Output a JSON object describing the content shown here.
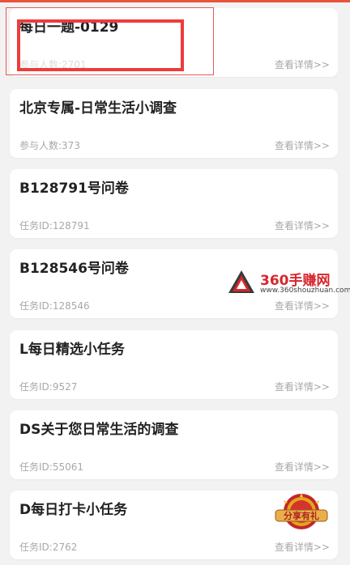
{
  "colors": {
    "accent": "#e8533a",
    "highlight": "#ef3b3b",
    "meta_text": "#a8a8a8"
  },
  "cards": [
    {
      "title": "每日一题-0129",
      "meta": "参与人数:2701",
      "link": "查看详情>>"
    },
    {
      "title": "北京专属-日常生活小调查",
      "meta": "参与人数:373",
      "link": "查看详情>>"
    },
    {
      "title": "B128791号问卷",
      "meta": "任务ID:128791",
      "link": "查看详情>>"
    },
    {
      "title": "B128546号问卷",
      "meta": "任务ID:128546",
      "link": "查看详情>>"
    },
    {
      "title": "L每日精选小任务",
      "meta": "任务ID:9527",
      "link": "查看详情>>"
    },
    {
      "title": "DS关于您日常生活的调查",
      "meta": "任务ID:55061",
      "link": "查看详情>>"
    },
    {
      "title": "D每日打卡小任务",
      "meta": "任务ID:2762",
      "link": "查看详情>>"
    }
  ],
  "watermark": {
    "title": "360手赚网",
    "url": "www.360shouzhuan.com"
  },
  "badge": {
    "label": "分享有礼"
  }
}
